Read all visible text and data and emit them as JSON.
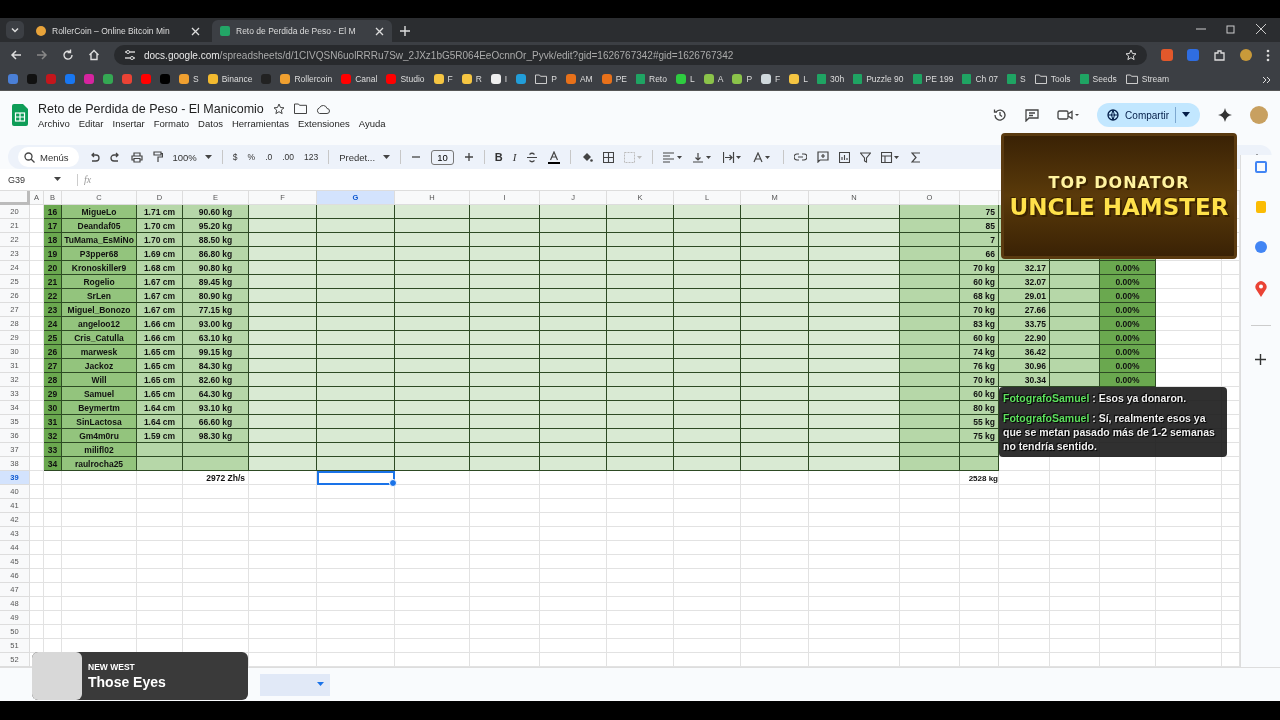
{
  "browser": {
    "tabs": [
      {
        "label": "RollerCoin – Online Bitcoin Min",
        "selected": false
      },
      {
        "label": "Reto de Perdida de Peso - El M",
        "selected": true
      }
    ],
    "url_host": "docs.google.com",
    "url_path": "/spreadsheets/d/1CIVQSN6uolRRRu7Sw_2JXz1bG5R064EeOcnnOr_Pyvk/edit?gid=1626767342#gid=1626767342",
    "bookmarks": [
      {
        "kind": "site",
        "color": "#4a7fd6"
      },
      {
        "kind": "site",
        "color": "#111111"
      },
      {
        "kind": "site",
        "color": "#c4161c"
      },
      {
        "kind": "site",
        "color": "#1877f2"
      },
      {
        "kind": "site",
        "color": "#d6249f"
      },
      {
        "kind": "site",
        "color": "#34a853"
      },
      {
        "kind": "site",
        "color": "#ea4335"
      },
      {
        "kind": "site",
        "color": "#ff0000"
      },
      {
        "kind": "site",
        "color": "#000000"
      },
      {
        "kind": "site",
        "color": "#f0a030",
        "label": "S"
      },
      {
        "kind": "site",
        "color": "#f3ba2f",
        "label": "Binance"
      },
      {
        "kind": "site",
        "color": "#222222"
      },
      {
        "kind": "site",
        "color": "#f0a030",
        "label": "Rollercoin"
      },
      {
        "kind": "site",
        "color": "#ff0000",
        "label": "Canal"
      },
      {
        "kind": "site",
        "color": "#ff0000",
        "label": "Studio"
      },
      {
        "kind": "site",
        "color": "#f5c542",
        "label": "F"
      },
      {
        "kind": "site",
        "color": "#f5c542",
        "label": "R"
      },
      {
        "kind": "site",
        "color": "#eeeeee",
        "label": "I"
      },
      {
        "kind": "site",
        "color": "#229ed9"
      },
      {
        "kind": "folder",
        "label": "P"
      },
      {
        "kind": "site",
        "color": "#e8711a",
        "label": "AM"
      },
      {
        "kind": "site",
        "color": "#e8711a",
        "label": "PE"
      },
      {
        "kind": "sheet",
        "label": "Reto"
      },
      {
        "kind": "site",
        "color": "#2ecc40",
        "label": "L"
      },
      {
        "kind": "site",
        "color": "#8bc34a",
        "label": "A"
      },
      {
        "kind": "site",
        "color": "#8bc34a",
        "label": "P"
      },
      {
        "kind": "site",
        "color": "#cfd8dc",
        "label": "F"
      },
      {
        "kind": "site",
        "color": "#f5c542",
        "label": "L"
      },
      {
        "kind": "sheet",
        "label": "30h"
      },
      {
        "kind": "sheet",
        "label": "Puzzle 90"
      },
      {
        "kind": "sheet",
        "label": "PE 199"
      },
      {
        "kind": "sheet",
        "label": "Ch 07"
      },
      {
        "kind": "sheet",
        "label": "S"
      },
      {
        "kind": "folder",
        "label": "Tools"
      },
      {
        "kind": "sheet",
        "label": "Seeds"
      },
      {
        "kind": "folder",
        "label": "Stream"
      }
    ]
  },
  "doc": {
    "title": "Reto de Perdida de Peso - El Manicomio",
    "menus": [
      "Archivo",
      "Editar",
      "Insertar",
      "Formato",
      "Datos",
      "Herramientas",
      "Extensiones",
      "Ayuda"
    ],
    "share": "Compartir"
  },
  "toolbar": {
    "search": "Menús",
    "zoom": "100%",
    "format_buttons": [
      "$",
      "%",
      ".0",
      ".00",
      "123"
    ],
    "font": "Predet...",
    "font_size": "10",
    "style_buttons": [
      "B",
      "I"
    ]
  },
  "name_box": "G39",
  "formula_label": "fx",
  "columns": [
    {
      "label": "A",
      "selected": false
    },
    {
      "label": "B",
      "selected": false
    },
    {
      "label": "C",
      "selected": false
    },
    {
      "label": "D",
      "selected": false
    },
    {
      "label": "E",
      "selected": false
    },
    {
      "label": "F",
      "selected": false
    },
    {
      "label": "G",
      "selected": true
    },
    {
      "label": "H",
      "selected": false
    },
    {
      "label": "I",
      "selected": false
    },
    {
      "label": "J",
      "selected": false
    },
    {
      "label": "K",
      "selected": false
    },
    {
      "label": "L",
      "selected": false
    },
    {
      "label": "M",
      "selected": false
    },
    {
      "label": "N",
      "selected": false
    },
    {
      "label": "O",
      "selected": false
    }
  ],
  "rows": [
    {
      "number": "20",
      "kind": "player",
      "selected": false,
      "b": "16",
      "name": "MigueLo",
      "height": "1.71 cm",
      "weight": "90.60 kg",
      "goal": "75"
    },
    {
      "number": "21",
      "kind": "player",
      "selected": false,
      "b": "17",
      "name": "Deandaf05",
      "height": "1.70 cm",
      "weight": "95.20 kg",
      "goal": "85"
    },
    {
      "number": "22",
      "kind": "player",
      "selected": false,
      "b": "18",
      "name": "TuMama_EsMiNo",
      "height": "1.70 cm",
      "weight": "88.50 kg",
      "goal": "7"
    },
    {
      "number": "23",
      "kind": "player",
      "selected": false,
      "b": "19",
      "name": "P3pper68",
      "height": "1.69 cm",
      "weight": "86.80 kg",
      "goal": "66"
    },
    {
      "number": "24",
      "kind": "player",
      "selected": false,
      "b": "20",
      "name": "Kronoskiller9",
      "height": "1.68 cm",
      "weight": "90.80 kg",
      "goal": "70 kg",
      "value": "32.17",
      "pct": "0.00%"
    },
    {
      "number": "25",
      "kind": "player",
      "selected": false,
      "b": "21",
      "name": "Rogelio",
      "height": "1.67 cm",
      "weight": "89.45 kg",
      "goal": "60 kg",
      "value": "32.07",
      "pct": "0.00%"
    },
    {
      "number": "26",
      "kind": "player",
      "selected": false,
      "b": "22",
      "name": "SrLen",
      "height": "1.67 cm",
      "weight": "80.90 kg",
      "goal": "68 kg",
      "value": "29.01",
      "pct": "0.00%"
    },
    {
      "number": "27",
      "kind": "player",
      "selected": false,
      "b": "23",
      "name": "Miguel_Bonozo",
      "height": "1.67 cm",
      "weight": "77.15 kg",
      "goal": "70 kg",
      "value": "27.66",
      "pct": "0.00%"
    },
    {
      "number": "28",
      "kind": "player",
      "selected": false,
      "b": "24",
      "name": "angeloo12",
      "height": "1.66 cm",
      "weight": "93.00 kg",
      "goal": "83 kg",
      "value": "33.75",
      "pct": "0.00%"
    },
    {
      "number": "29",
      "kind": "player",
      "selected": false,
      "b": "25",
      "name": "Cris_Catulla",
      "height": "1.66 cm",
      "weight": "63.10 kg",
      "goal": "60 kg",
      "value": "22.90",
      "pct": "0.00%"
    },
    {
      "number": "30",
      "kind": "player",
      "selected": false,
      "b": "26",
      "name": "marwesk",
      "height": "1.65 cm",
      "weight": "99.15 kg",
      "goal": "74 kg",
      "value": "36.42",
      "pct": "0.00%"
    },
    {
      "number": "31",
      "kind": "player",
      "selected": false,
      "b": "27",
      "name": "Jackoz",
      "height": "1.65 cm",
      "weight": "84.30 kg",
      "goal": "76 kg",
      "value": "30.96",
      "pct": "0.00%"
    },
    {
      "number": "32",
      "kind": "player",
      "selected": false,
      "b": "28",
      "name": "Will",
      "height": "1.65 cm",
      "weight": "82.60 kg",
      "goal": "70 kg",
      "value": "30.34",
      "pct": "0.00%"
    },
    {
      "number": "33",
      "kind": "player",
      "selected": false,
      "b": "29",
      "name": "Samuel",
      "height": "1.65 cm",
      "weight": "64.30 kg",
      "goal": "60 kg"
    },
    {
      "number": "34",
      "kind": "player",
      "selected": false,
      "b": "30",
      "name": "Beymertm",
      "height": "1.64 cm",
      "weight": "93.10 kg",
      "goal": "80 kg"
    },
    {
      "number": "35",
      "kind": "player",
      "selected": false,
      "b": "31",
      "name": "SinLactosa",
      "height": "1.64 cm",
      "weight": "66.60 kg",
      "goal": "55 kg"
    },
    {
      "number": "36",
      "kind": "player",
      "selected": false,
      "b": "32",
      "name": "Gm4m0ru",
      "height": "1.59 cm",
      "weight": "98.30 kg",
      "goal": "75 kg"
    },
    {
      "number": "37",
      "kind": "player",
      "selected": false,
      "b": "33",
      "name": "milifl02"
    },
    {
      "number": "38",
      "kind": "player",
      "selected": false,
      "b": "34",
      "name": "raulrocha25"
    },
    {
      "number": "39",
      "kind": "total",
      "selected": true,
      "weight": "2972 Zh/s",
      "goal": "2528 kg"
    },
    {
      "number": "40",
      "kind": "empty",
      "selected": false
    },
    {
      "number": "41",
      "kind": "empty",
      "selected": false
    },
    {
      "number": "42",
      "kind": "empty",
      "selected": false
    },
    {
      "number": "43",
      "kind": "empty",
      "selected": false
    },
    {
      "number": "44",
      "kind": "empty",
      "selected": false
    },
    {
      "number": "45",
      "kind": "empty",
      "selected": false
    },
    {
      "number": "46",
      "kind": "empty",
      "selected": false
    },
    {
      "number": "47",
      "kind": "empty",
      "selected": false
    },
    {
      "number": "48",
      "kind": "empty",
      "selected": false
    },
    {
      "number": "49",
      "kind": "empty",
      "selected": false
    },
    {
      "number": "50",
      "kind": "empty",
      "selected": false
    },
    {
      "number": "51",
      "kind": "empty",
      "selected": false
    },
    {
      "number": "52",
      "kind": "empty",
      "selected": false
    }
  ],
  "overlays": {
    "banner": {
      "kicker": "TOP DONATOR",
      "title": "UNCLE HAMSTER"
    },
    "chat": [
      {
        "user": "FotografoSamuel",
        "text": ": Esos ya donaron."
      },
      {
        "user": "FotografoSamuel",
        "text": ": Sí, realmente esos ya que se metan pasado más de 1-2 semanas no tendría sentido."
      }
    ],
    "now_playing": {
      "artist": "NEW WEST",
      "song": "Those Eyes"
    }
  }
}
